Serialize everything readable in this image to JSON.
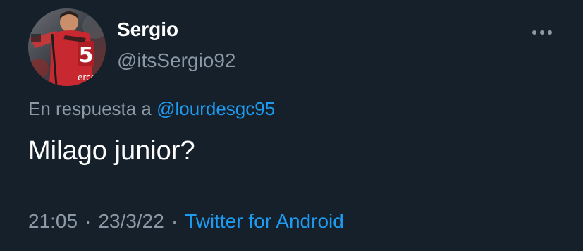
{
  "author": {
    "display_name": "Sergio",
    "handle": "@itsSergio92",
    "avatar_icon": "profile-photo-football-player",
    "avatar_jersey_number": "5",
    "avatar_jersey_text": "erco"
  },
  "menu": {
    "icon": "more-horizontal-icon"
  },
  "reply": {
    "prefix": "En respuesta a",
    "mention": "@lourdesgc95"
  },
  "tweet": {
    "text": "Milago junior?"
  },
  "meta": {
    "time": "21:05",
    "separator": "·",
    "date": "23/3/22",
    "source": "Twitter for Android"
  },
  "colors": {
    "background": "#15202b",
    "primary_text": "#ffffff",
    "secondary_text": "#8b98a5",
    "accent": "#1d9bf0"
  }
}
